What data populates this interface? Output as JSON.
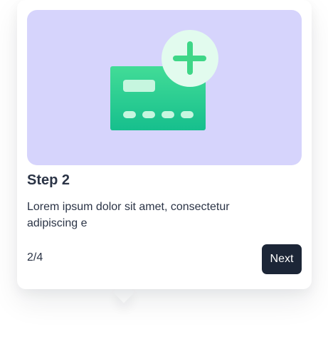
{
  "tour": {
    "illustration_icon": "credit-card-add-icon",
    "title": "Step 2",
    "description": "Lorem ipsum dolor sit amet, consectetur adipiscing e",
    "progress": "2/4",
    "next_label": "Next"
  },
  "colors": {
    "hero_background": "#d6d4fc",
    "card_gradient_top": "#42dc97",
    "card_gradient_bottom": "#16bf8d",
    "badge_background": "#e2fbee",
    "plus_color": "#3ed687",
    "button_background": "#1c2637",
    "text_color": "#2b3446"
  }
}
